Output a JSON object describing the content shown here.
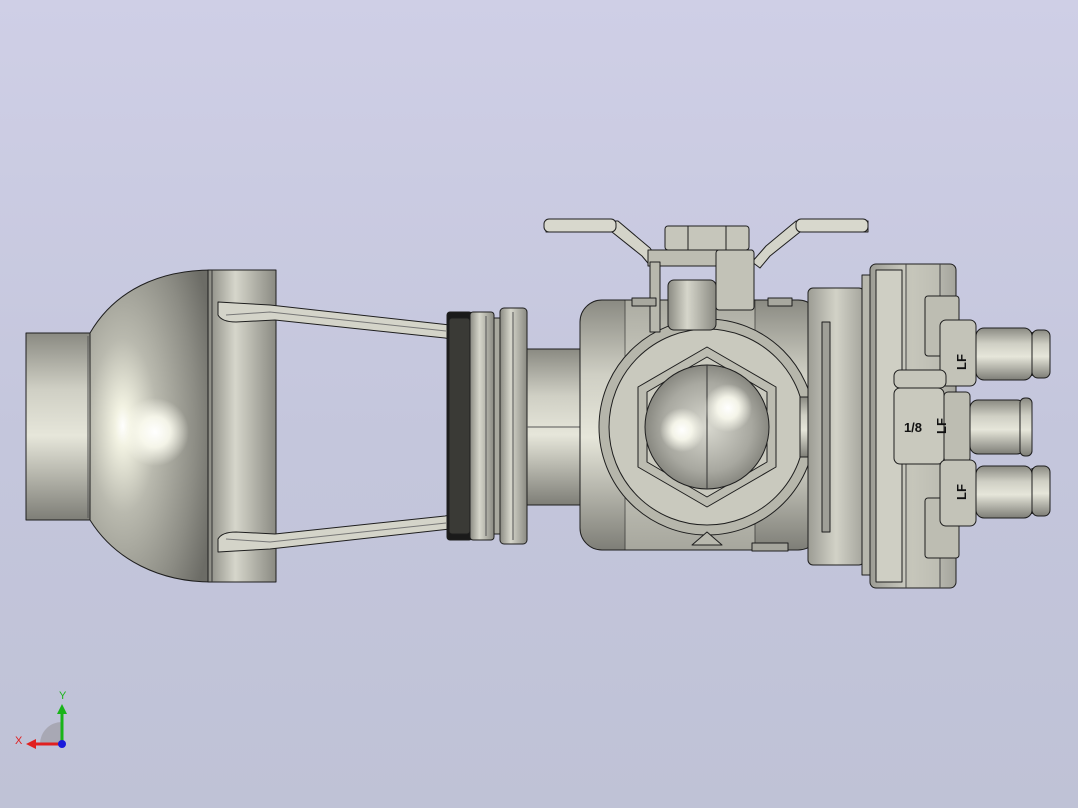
{
  "model": {
    "stamps": {
      "top_port": "LF",
      "middle_port": "LF",
      "middle_port_size": "1/8",
      "bottom_port": "LF"
    }
  },
  "triad": {
    "x_label": "X",
    "y_label": "Y",
    "x_color": "#e02020",
    "y_color": "#19b419",
    "z_color": "#1a1adb"
  },
  "colors": {
    "background": "#c7c9df",
    "metal": "#bdbdb2",
    "outline": "#1e1e1e"
  }
}
